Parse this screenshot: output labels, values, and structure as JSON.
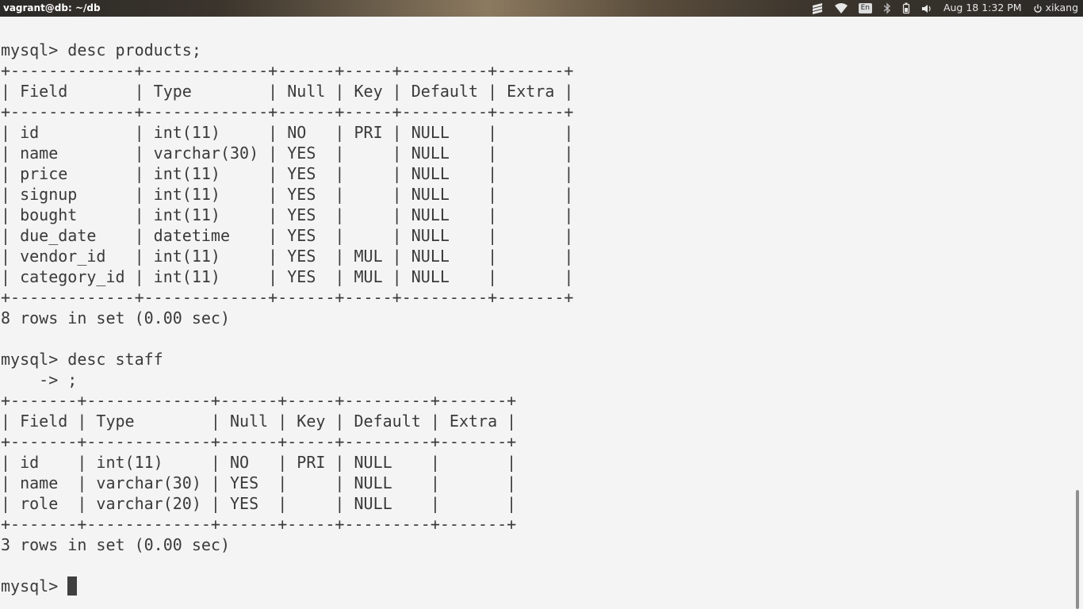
{
  "topbar": {
    "window_title": "vagrant@db: ~/db",
    "indicators": {
      "session_icon": "stacked-layers-icon",
      "wifi_icon": "wifi-icon",
      "keyboard_layout": "En",
      "bluetooth_icon": "bluetooth-icon",
      "battery_icon": "battery-icon",
      "volume_icon": "volume-icon"
    },
    "clock": "Aug 18  1:32 PM",
    "user": "xikang"
  },
  "terminal": {
    "lines": [
      "mysql> desc products;",
      "+-------------+-------------+------+-----+---------+-------+",
      "| Field       | Type        | Null | Key | Default | Extra |",
      "+-------------+-------------+------+-----+---------+-------+",
      "| id          | int(11)     | NO   | PRI | NULL    |       |",
      "| name        | varchar(30) | YES  |     | NULL    |       |",
      "| price       | int(11)     | YES  |     | NULL    |       |",
      "| signup      | int(11)     | YES  |     | NULL    |       |",
      "| bought      | int(11)     | YES  |     | NULL    |       |",
      "| due_date    | datetime    | YES  |     | NULL    |       |",
      "| vendor_id   | int(11)     | YES  | MUL | NULL    |       |",
      "| category_id | int(11)     | YES  | MUL | NULL    |       |",
      "+-------------+-------------+------+-----+---------+-------+",
      "8 rows in set (0.00 sec)",
      "",
      "mysql> desc staff",
      "    -> ;",
      "+-------+-------------+------+-----+---------+-------+",
      "| Field | Type        | Null | Key | Default | Extra |",
      "+-------+-------------+------+-----+---------+-------+",
      "| id    | int(11)     | NO   | PRI | NULL    |       |",
      "| name  | varchar(30) | YES  |     | NULL    |       |",
      "| role  | varchar(20) | YES  |     | NULL    |       |",
      "+-------+-------------+------+-----+---------+-------+",
      "3 rows in set (0.00 sec)",
      ""
    ],
    "prompt": "mysql> "
  }
}
